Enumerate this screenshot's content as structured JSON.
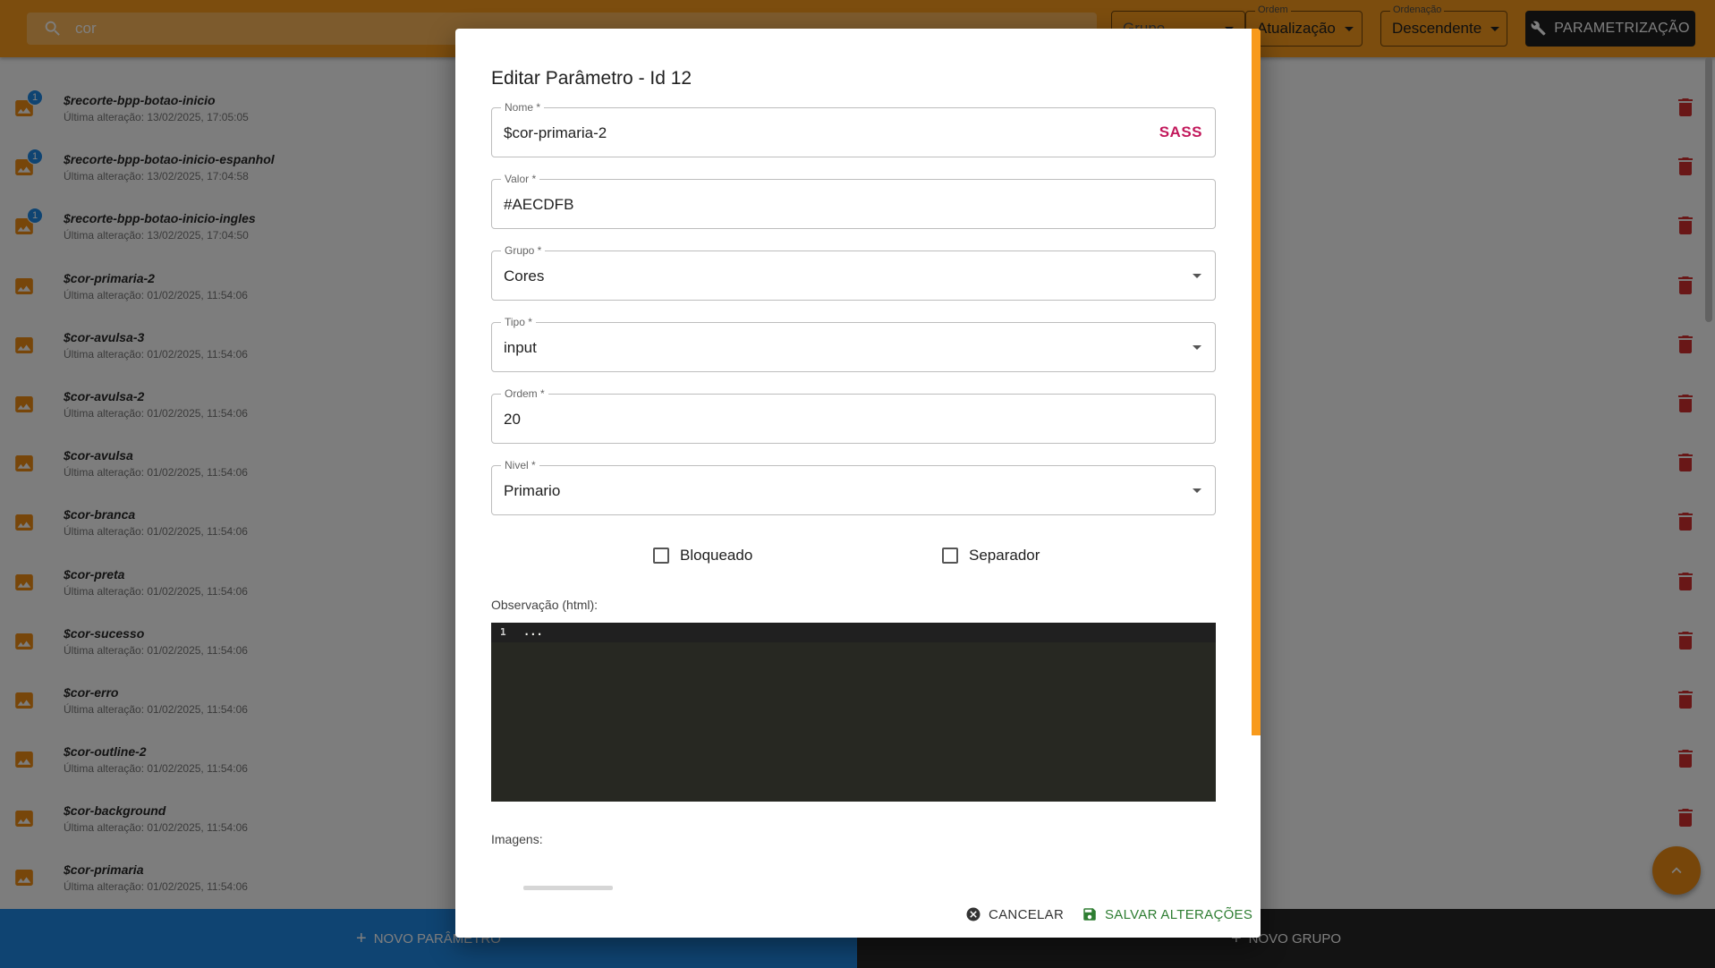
{
  "topbar": {
    "search_value": "cor",
    "group_select_label": "Grupo",
    "order_label": "Ordem",
    "order_value": "Atualização",
    "sort_label": "Ordenação",
    "sort_value": "Descendente",
    "param_button": "PARAMETRIZAÇÃO"
  },
  "list": [
    {
      "name": "$recorte-bpp-botao-inicio",
      "date": "Última alteração: 13/02/2025, 17:05:05",
      "badge": "1"
    },
    {
      "name": "$recorte-bpp-botao-inicio-espanhol",
      "date": "Última alteração: 13/02/2025, 17:04:58",
      "badge": "1"
    },
    {
      "name": "$recorte-bpp-botao-inicio-ingles",
      "date": "Última alteração: 13/02/2025, 17:04:50",
      "badge": "1"
    },
    {
      "name": "$cor-primaria-2",
      "date": "Última alteração: 01/02/2025, 11:54:06"
    },
    {
      "name": "$cor-avulsa-3",
      "date": "Última alteração: 01/02/2025, 11:54:06"
    },
    {
      "name": "$cor-avulsa-2",
      "date": "Última alteração: 01/02/2025, 11:54:06"
    },
    {
      "name": "$cor-avulsa",
      "date": "Última alteração: 01/02/2025, 11:54:06"
    },
    {
      "name": "$cor-branca",
      "date": "Última alteração: 01/02/2025, 11:54:06"
    },
    {
      "name": "$cor-preta",
      "date": "Última alteração: 01/02/2025, 11:54:06"
    },
    {
      "name": "$cor-sucesso",
      "date": "Última alteração: 01/02/2025, 11:54:06"
    },
    {
      "name": "$cor-erro",
      "date": "Última alteração: 01/02/2025, 11:54:06"
    },
    {
      "name": "$cor-outline-2",
      "date": "Última alteração: 01/02/2025, 11:54:06"
    },
    {
      "name": "$cor-background",
      "date": "Última alteração: 01/02/2025, 11:54:06"
    },
    {
      "name": "$cor-primaria",
      "date": "Última alteração: 01/02/2025, 11:54:06"
    }
  ],
  "bottom": {
    "new_param": "NOVO PARÂMETRO",
    "new_group": "NOVO GRUPO"
  },
  "dialog": {
    "title": "Editar Parâmetro - Id 12",
    "fields": {
      "nome": {
        "label": "Nome *",
        "value": "$cor-primaria-2",
        "adornment": "SASS"
      },
      "valor": {
        "label": "Valor *",
        "value": "#AECDFB"
      },
      "grupo": {
        "label": "Grupo *",
        "value": "Cores"
      },
      "tipo": {
        "label": "Tipo *",
        "value": "input"
      },
      "ordem": {
        "label": "Ordem *",
        "value": "20"
      },
      "nivel": {
        "label": "Nivel *",
        "value": "Primario"
      }
    },
    "checkboxes": {
      "bloqueado": "Bloqueado",
      "separador": "Separador"
    },
    "observacao_label": "Observação (html):",
    "editor": {
      "line_number": "1",
      "code": "..."
    },
    "imagens_label": "Imagens:",
    "cancel": "CANCELAR",
    "save": "SALVAR ALTERAÇÕES"
  },
  "colors": {
    "topbar": "#f89a1c",
    "accent_blue": "#1e88e5",
    "danger": "#d32f2f",
    "sass_badge": "#c2185b",
    "save": "#2e7d32",
    "editor_bg": "#272822"
  }
}
